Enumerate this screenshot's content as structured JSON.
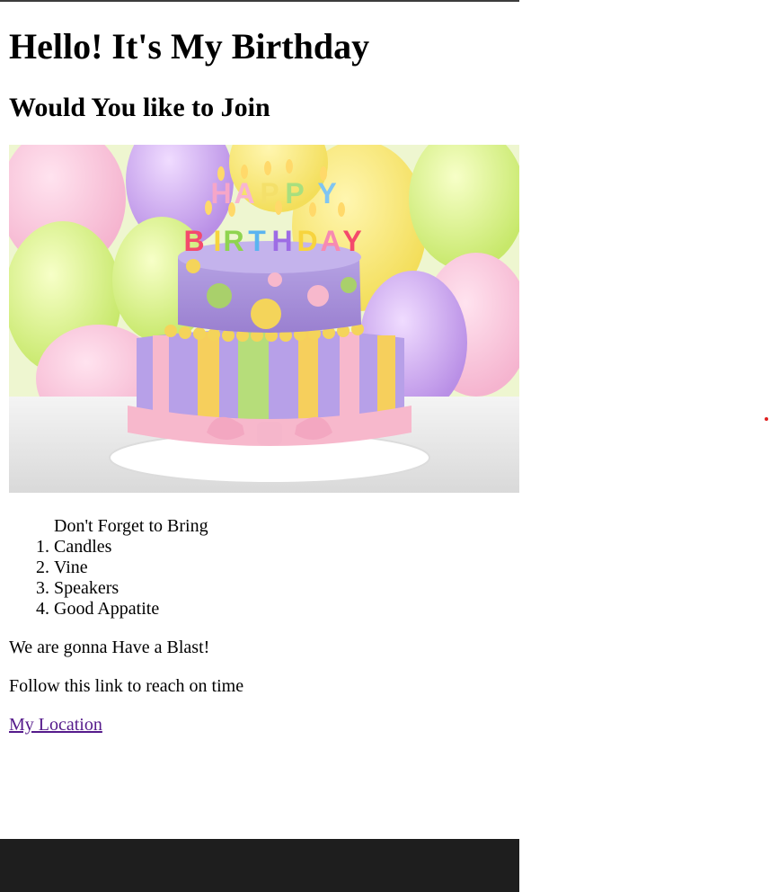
{
  "heading": "Hello! It's My Birthday",
  "subheading": "Would You like to Join",
  "image": {
    "icon": "birthday-cake-image",
    "cake_lettering": [
      "HAPPY",
      "BIRTHDAY"
    ],
    "colors": {
      "background_balloons": "#e9f59a",
      "cake_top": "#a28ad8",
      "cake_bottom": "#b7a0e8",
      "ribbon": "#f7b8cc",
      "stripes": "#f6cf5c",
      "table": "#eeeeee"
    }
  },
  "list": {
    "caption": "Don't Forget to Bring",
    "items": [
      "Candles",
      "Vine",
      "Speakers",
      "Good Appatite"
    ]
  },
  "paragraph1": "We are gonna Have a Blast!",
  "paragraph2": "Follow this link to reach on time",
  "link_label": "My Location",
  "colors": {
    "link_visited": "#551a8b",
    "footer": "#1e1e1e",
    "top_border": "#3c3c3c",
    "marker_dot": "#e02020"
  }
}
